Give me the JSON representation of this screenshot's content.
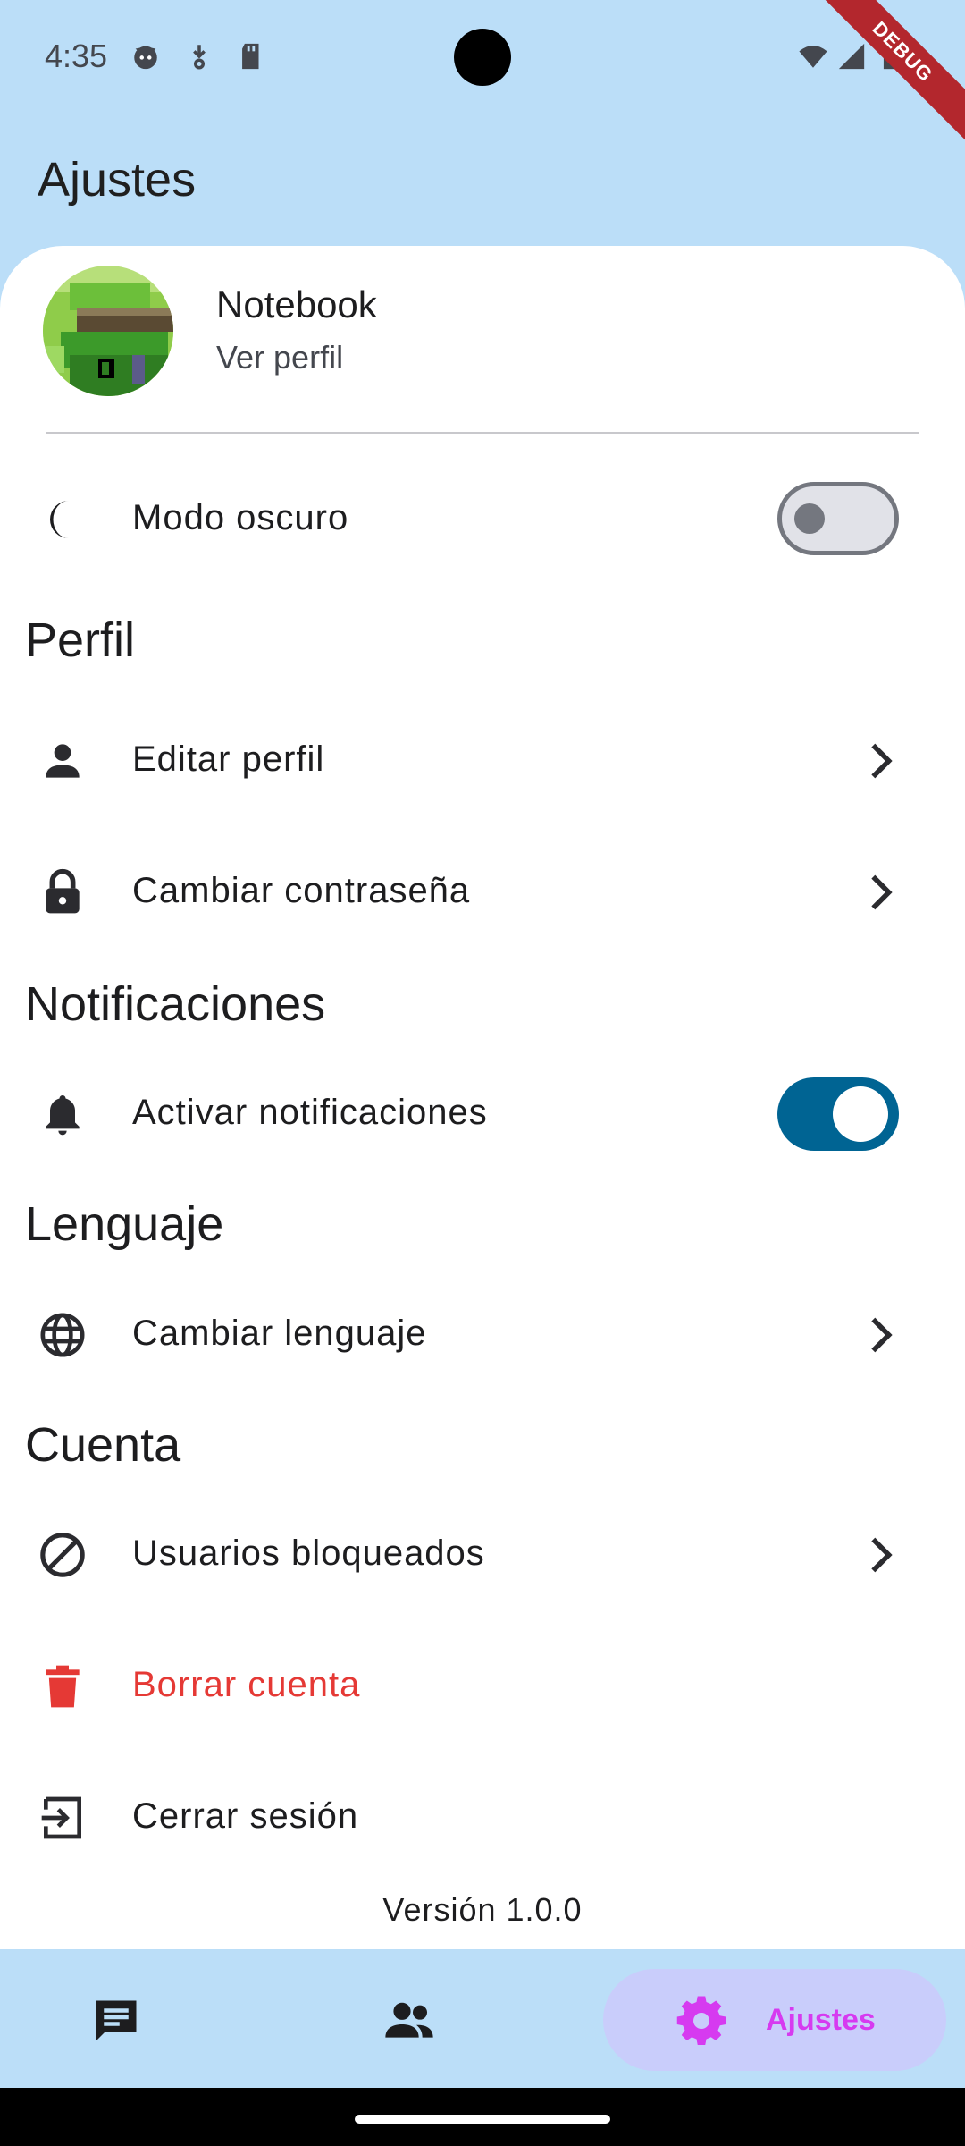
{
  "status_bar": {
    "time": "4:35",
    "debug_label": "DEBUG"
  },
  "app_bar": {
    "title": "Ajustes"
  },
  "profile": {
    "name": "Notebook",
    "subtitle": "Ver perfil"
  },
  "dark_mode": {
    "label": "Modo oscuro",
    "enabled": false
  },
  "sections": {
    "perfil": {
      "title": "Perfil",
      "items": [
        {
          "label": "Editar perfil",
          "icon": "person-icon"
        },
        {
          "label": "Cambiar contraseña",
          "icon": "lock-icon"
        }
      ]
    },
    "notificaciones": {
      "title": "Notificaciones",
      "items": [
        {
          "label": "Activar notificaciones",
          "icon": "bell-icon",
          "enabled": true
        }
      ]
    },
    "lenguaje": {
      "title": "Lenguaje",
      "items": [
        {
          "label": "Cambiar lenguaje",
          "icon": "globe-icon"
        }
      ]
    },
    "cuenta": {
      "title": "Cuenta",
      "items": [
        {
          "label": "Usuarios bloqueados",
          "icon": "block-icon"
        },
        {
          "label": "Borrar cuenta",
          "icon": "trash-icon",
          "color": "#E53935"
        },
        {
          "label": "Cerrar sesión",
          "icon": "logout-icon"
        }
      ]
    }
  },
  "version": "Versión 1.0.0",
  "bottom_nav": {
    "items": [
      {
        "icon": "chat-icon"
      },
      {
        "icon": "people-icon"
      },
      {
        "icon": "gear-icon",
        "label": "Ajustes",
        "active": true
      }
    ]
  },
  "colors": {
    "background": "#BBDEF8",
    "accent": "#006493",
    "danger": "#E53935",
    "nav_active_label": "#D63AF0",
    "nav_active_pill": "#C9CDFB"
  }
}
